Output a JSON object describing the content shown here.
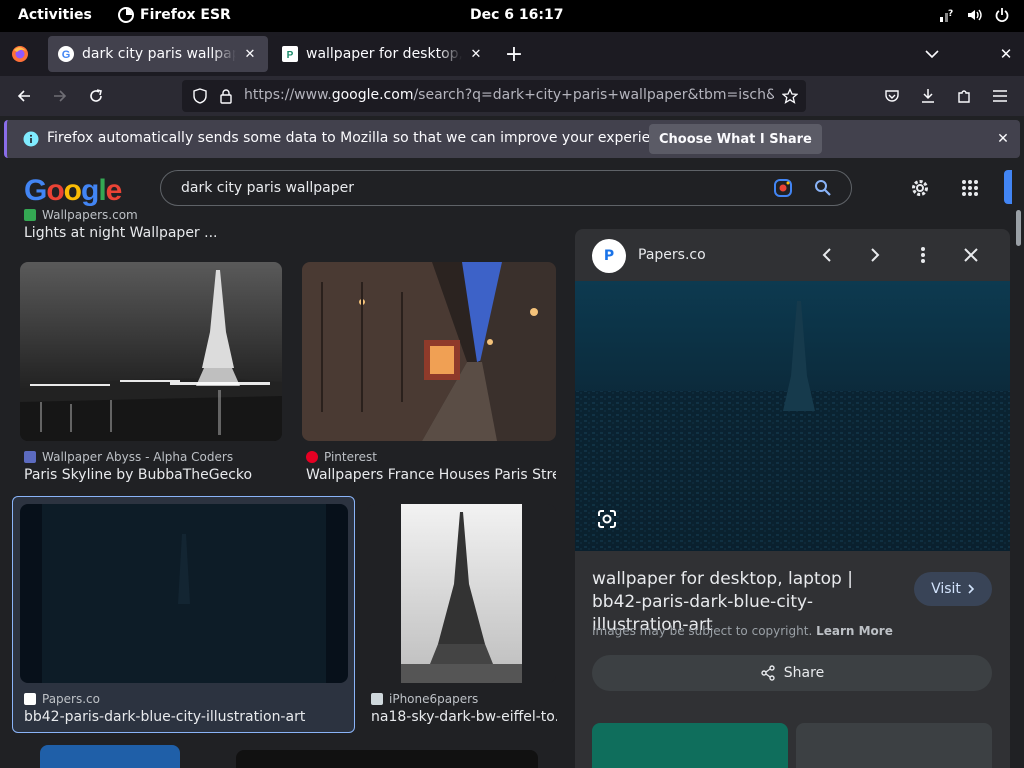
{
  "system": {
    "activities": "Activities",
    "app_name": "Firefox ESR",
    "clock": "Dec 6  16:17"
  },
  "tabs": [
    {
      "title": "dark city paris wallpaper",
      "active": true,
      "favicon": "google-icon"
    },
    {
      "title": "wallpaper for desktop, laptop",
      "active": false,
      "favicon": "papers-icon"
    }
  ],
  "navbar": {
    "url_host_prefix": "https://www.",
    "url_host": "google.com",
    "url_path": "/search?q=dark+city+paris+wallpaper&tbm=isch&ve"
  },
  "notification": {
    "message": "Firefox automatically sends some data to Mozilla so that we can improve your experience.",
    "button": "Choose What I Share"
  },
  "google": {
    "logo": "Google",
    "query": "dark city paris wallpaper"
  },
  "results": [
    {
      "source": "Wallpapers.com",
      "caption": "Lights at night Wallpaper ..."
    },
    {
      "source": "Wallpaper Abyss - Alpha Coders",
      "caption": "Paris Skyline by BubbaTheGecko"
    },
    {
      "source": "Pinterest",
      "caption": "Wallpapers France Houses Paris Stre..."
    },
    {
      "source": "Papers.co",
      "caption": "bb42-paris-dark-blue-city-illustration-art"
    },
    {
      "source": "iPhone6papers",
      "caption": "na18-sky-dark-bw-eiffel-to..."
    }
  ],
  "panel": {
    "site_initial": "P",
    "site_name": "Papers.co",
    "title": "wallpaper for desktop, laptop | bb42-paris-dark-blue-city-illustration-art",
    "visit": "Visit",
    "copyright": "Images may be subject to copyright.",
    "learn_more": "Learn More",
    "share": "Share"
  },
  "colors": {
    "google_blue": "#4285f4",
    "google_red": "#ea4335",
    "google_yellow": "#fbbc05",
    "google_green": "#34a853",
    "selected_outline": "#8ab4f8"
  }
}
